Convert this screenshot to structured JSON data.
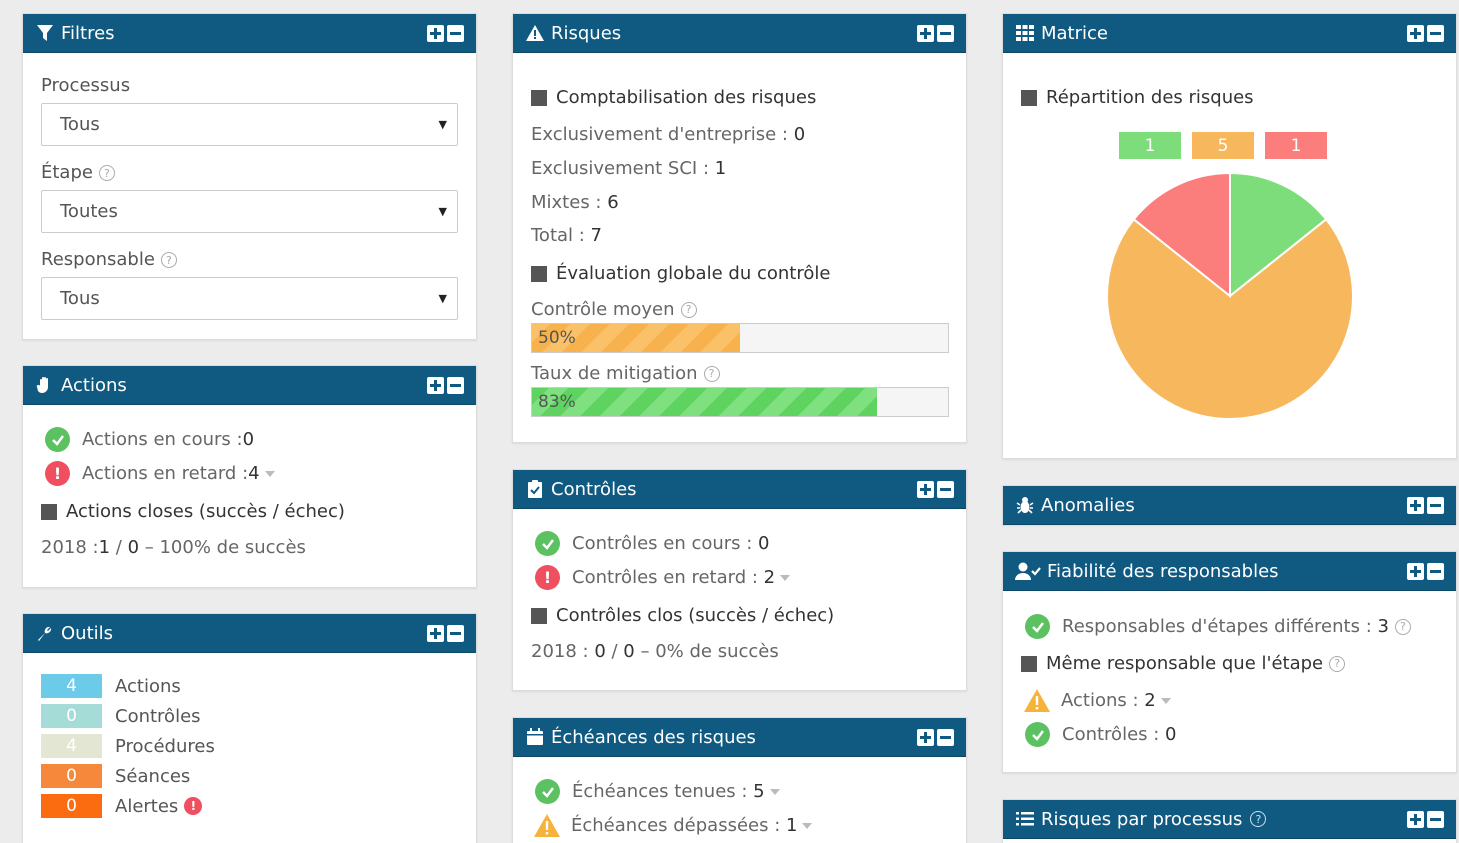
{
  "colors": {
    "header": "#105a82",
    "green": "#7ddd7a",
    "orange": "#f7b75d",
    "red": "#fb7d7c",
    "teal": "#7dcbe6"
  },
  "filtres": {
    "title": "Filtres",
    "fields": [
      {
        "label": "Processus",
        "value": "Tous",
        "help": false
      },
      {
        "label": "Étape",
        "value": "Toutes",
        "help": true
      },
      {
        "label": "Responsable",
        "value": "Tous",
        "help": true
      }
    ]
  },
  "actions": {
    "title": "Actions",
    "en_cours_label": "Actions en cours : ",
    "en_cours_value": "0",
    "en_retard_label": "Actions en retard : ",
    "en_retard_value": "4",
    "closes_title": "Actions closes (succès / échec)",
    "closes_year": "2018 : ",
    "closes_success": "1",
    "closes_sep": " / ",
    "closes_fail": "0",
    "closes_pct": " – 100% de succès"
  },
  "outils": {
    "title": "Outils",
    "items": [
      {
        "count": "4",
        "label": "Actions",
        "color": "#6ccbe8"
      },
      {
        "count": "0",
        "label": "Contrôles",
        "color": "#a6dcd8"
      },
      {
        "count": "4",
        "label": "Procédures",
        "color": "#e3e6d2"
      },
      {
        "count": "0",
        "label": "Séances",
        "color": "#f5883a"
      },
      {
        "count": "0",
        "label": "Alertes",
        "color": "#fb6b0f"
      }
    ]
  },
  "risques": {
    "title": "Risques",
    "compta_title": "Comptabilisation des risques",
    "lines": [
      {
        "label": "Exclusivement d'entreprise : ",
        "value": "0"
      },
      {
        "label": "Exclusivement SCI : ",
        "value": "1"
      },
      {
        "label": "Mixtes : ",
        "value": "6"
      },
      {
        "label": "Total : ",
        "value": "7"
      }
    ],
    "eval_title": "Évaluation globale du contrôle",
    "controle_moyen_label": "Contrôle moyen",
    "controle_moyen_pct": 50,
    "controle_moyen_text": "50%",
    "taux_label": "Taux de mitigation",
    "taux_pct": 83,
    "taux_text": "83%"
  },
  "controles": {
    "title": "Contrôles",
    "en_cours_label": "Contrôles en cours : ",
    "en_cours_value": "0",
    "en_retard_label": "Contrôles en retard : ",
    "en_retard_value": "2",
    "clos_title": "Contrôles clos (succès / échec)",
    "clos_year": "2018 : ",
    "clos_success": "0",
    "clos_sep": " / ",
    "clos_fail": "0",
    "clos_pct": " – 0% de succès"
  },
  "echeances": {
    "title": "Échéances des risques",
    "tenues_label": "Échéances tenues : ",
    "tenues_value": "5",
    "depassees_label": "Échéances dépassées : ",
    "depassees_value": "1"
  },
  "matrice": {
    "title": "Matrice",
    "repartition_title": "Répartition des risques"
  },
  "chart_data": {
    "type": "pie",
    "title": "Répartition des risques",
    "categories": [
      "",
      "",
      ""
    ],
    "values": [
      1,
      5,
      1
    ],
    "colors": [
      "#7ddd7a",
      "#f7b75d",
      "#fb7d7c"
    ]
  },
  "anomalies": {
    "title": "Anomalies"
  },
  "fiabilite": {
    "title": "Fiabilité des responsables",
    "diff_label": "Responsables d'étapes différents : ",
    "diff_value": "3",
    "meme_title": "Même responsable que l'étape",
    "actions_label": "Actions : ",
    "actions_value": "2",
    "controles_label": "Contrôles : ",
    "controles_value": "0"
  },
  "risques_processus": {
    "title": "Risques par processus"
  },
  "help_glyph": "?"
}
